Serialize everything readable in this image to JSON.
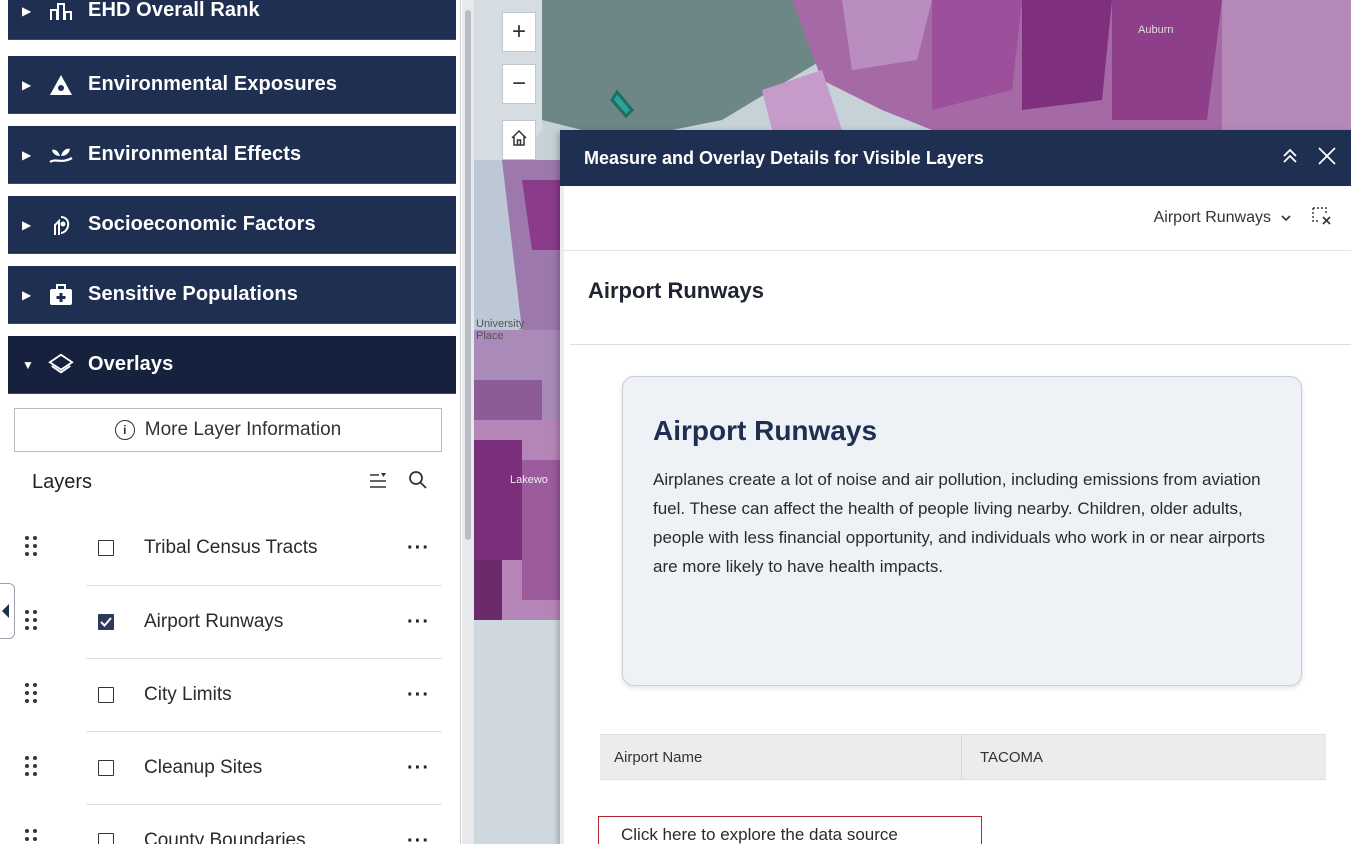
{
  "sidebar": {
    "categories": [
      {
        "label": "EHD Overall Rank",
        "icon": "rank-chart-icon"
      },
      {
        "label": "Environmental Exposures",
        "icon": "hazard-icon"
      },
      {
        "label": "Environmental Effects",
        "icon": "plant-hand-icon"
      },
      {
        "label": "Socioeconomic Factors",
        "icon": "money-hand-icon"
      },
      {
        "label": "Sensitive Populations",
        "icon": "medical-kit-icon"
      },
      {
        "label": "Overlays",
        "icon": "layers-icon"
      }
    ],
    "more_info_label": "More Layer Information",
    "layers_title": "Layers",
    "layers": [
      {
        "label": "Tribal Census Tracts",
        "checked": false
      },
      {
        "label": "Airport Runways",
        "checked": true
      },
      {
        "label": "City Limits",
        "checked": false
      },
      {
        "label": "Cleanup Sites",
        "checked": false
      },
      {
        "label": "County Boundaries",
        "checked": false
      }
    ],
    "more_menu_glyph": "···"
  },
  "map": {
    "zoom_in": "+",
    "zoom_out": "−",
    "labels": {
      "auburn": "Auburn",
      "university_place": "University Place",
      "lakewood": "Lakewo"
    }
  },
  "panel": {
    "title": "Measure and Overlay Details for Visible Layers",
    "selected_layer": "Airport Runways",
    "feature_title": "Airport Runways",
    "card_title": "Airport Runways",
    "card_body": "Airplanes create a lot of noise and air pollution, including emissions from aviation fuel. These can affect the health of people living nearby. Children, older adults, people with less financial opportunity, and individuals who work in or near airports are more likely to have health impacts.",
    "table": {
      "key": "Airport Name",
      "value": "TACOMA"
    },
    "source_link": "Click here to explore the data source"
  },
  "colors": {
    "navy": "#1f2f52",
    "link_border": "#b3242e"
  }
}
